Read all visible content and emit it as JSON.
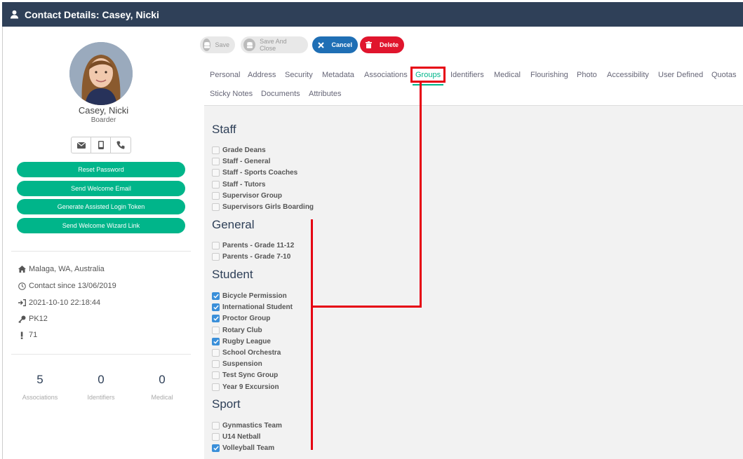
{
  "window": {
    "title": "Contact Details: Casey, Nicki"
  },
  "profile": {
    "name": "Casey, Nicki",
    "role": "Boarder"
  },
  "actions": [
    {
      "label": "Reset Password"
    },
    {
      "label": "Send Welcome Email"
    },
    {
      "label": "Generate Assisted Login Token"
    },
    {
      "label": "Send Welcome Wizard Link"
    }
  ],
  "info": {
    "location": "Malaga, WA, Australia",
    "since": "Contact since 13/06/2019",
    "last_login": "2021-10-10 22:18:44",
    "key": "PK12",
    "alert": "71"
  },
  "stats": [
    {
      "value": "5",
      "label": "Associations"
    },
    {
      "value": "0",
      "label": "Identifiers"
    },
    {
      "value": "0",
      "label": "Medical"
    }
  ],
  "toolbar": {
    "save": "Save",
    "save_close": "Save And Close",
    "cancel": "Cancel",
    "delete": "Delete"
  },
  "tabs": [
    "Personal",
    "Address",
    "Security",
    "Metadata",
    "Associations",
    "Groups",
    "Identifiers",
    "Medical",
    "Flourishing",
    "Photo",
    "Accessibility",
    "User Defined",
    "Quotas",
    "Sticky Notes",
    "Documents",
    "Attributes"
  ],
  "active_tab": "Groups",
  "groups": {
    "staff": {
      "title": "Staff",
      "items": [
        {
          "label": "Grade Deans",
          "checked": false
        },
        {
          "label": "Staff - General",
          "checked": false
        },
        {
          "label": "Staff - Sports Coaches",
          "checked": false
        },
        {
          "label": "Staff - Tutors",
          "checked": false
        },
        {
          "label": "Supervisor Group",
          "checked": false
        },
        {
          "label": "Supervisors Girls Boarding",
          "checked": false
        }
      ]
    },
    "general": {
      "title": "General",
      "items": [
        {
          "label": "Parents - Grade 11-12",
          "checked": false
        },
        {
          "label": "Parents - Grade 7-10",
          "checked": false
        }
      ]
    },
    "student": {
      "title": "Student",
      "items": [
        {
          "label": "Bicycle Permission",
          "checked": true
        },
        {
          "label": "International Student",
          "checked": true
        },
        {
          "label": "Proctor Group",
          "checked": true
        },
        {
          "label": "Rotary Club",
          "checked": false
        },
        {
          "label": "Rugby League",
          "checked": true
        },
        {
          "label": "School Orchestra",
          "checked": false
        },
        {
          "label": "Suspension",
          "checked": false
        },
        {
          "label": "Test Sync Group",
          "checked": false
        },
        {
          "label": "Year 9 Excursion",
          "checked": false
        }
      ]
    },
    "sport": {
      "title": "Sport",
      "items": [
        {
          "label": "Gynmastics Team",
          "checked": false
        },
        {
          "label": "U14 Netball",
          "checked": false
        },
        {
          "label": "Volleyball Team",
          "checked": true
        }
      ]
    }
  },
  "colors": {
    "titlebar": "#2f4058",
    "accent": "#00b58a",
    "cancel": "#1f6fb5",
    "delete": "#e0152d",
    "annotation": "#e60012"
  }
}
